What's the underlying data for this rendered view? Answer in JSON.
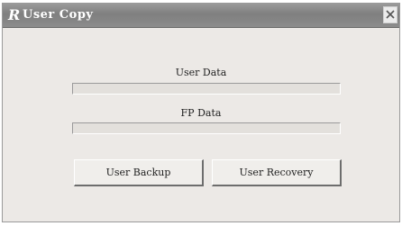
{
  "window": {
    "title": "User Copy",
    "icon": "R"
  },
  "user_data": {
    "label": "User Data",
    "progress": 0
  },
  "fp_data": {
    "label": "FP Data",
    "progress": 0
  },
  "buttons": {
    "backup": "User Backup",
    "recovery": "User Recovery"
  }
}
